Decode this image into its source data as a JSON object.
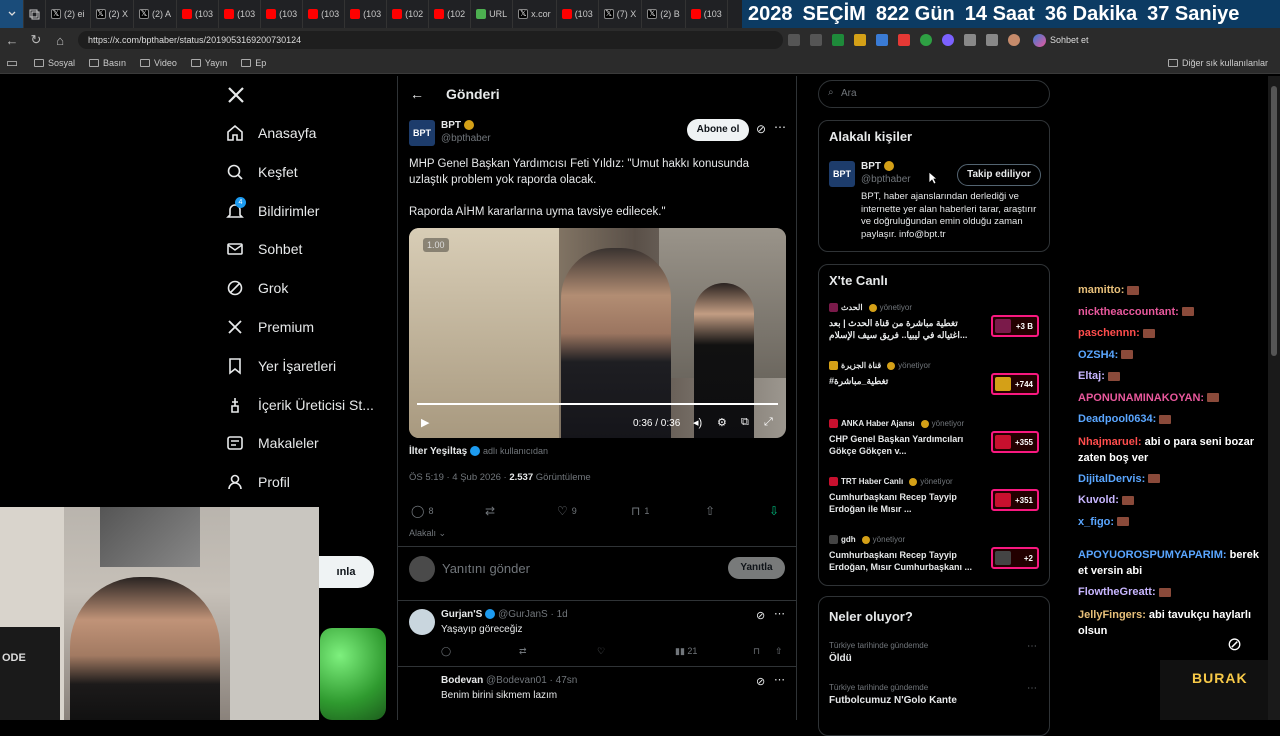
{
  "browser": {
    "tabs": [
      {
        "label": "(2) ei",
        "kind": "x"
      },
      {
        "label": "(2) X",
        "kind": "x"
      },
      {
        "label": "(2) A",
        "kind": "x"
      },
      {
        "label": "(103",
        "kind": "yt"
      },
      {
        "label": "(103",
        "kind": "yt"
      },
      {
        "label": "(103",
        "kind": "yt"
      },
      {
        "label": "(103",
        "kind": "yt"
      },
      {
        "label": "(103",
        "kind": "yt"
      },
      {
        "label": "(102",
        "kind": "yt"
      },
      {
        "label": "(102",
        "kind": "yt"
      },
      {
        "label": "URL",
        "kind": "other"
      },
      {
        "label": "x.cor",
        "kind": "x"
      },
      {
        "label": "(103",
        "kind": "yt"
      },
      {
        "label": "(7) X",
        "kind": "x"
      },
      {
        "label": "(2) B",
        "kind": "x"
      },
      {
        "label": "(103",
        "kind": "yt"
      }
    ],
    "url": "https://x.com/bpthaber/status/2019053169200730124",
    "copilot_label": "Sohbet et",
    "bookmarks": [
      "Sosyal",
      "Basın",
      "Video",
      "Yayın",
      "Ep"
    ],
    "other_bookmarks": "Diğer sık kullanılanlar"
  },
  "countdown": {
    "year": "2028",
    "word": "SEÇİM",
    "days": "822 Gün",
    "hours": "14 Saat",
    "minutes": "36 Dakika",
    "seconds": "37 Saniye"
  },
  "leftnav": {
    "items": [
      {
        "label": "Anasayfa",
        "icon": "home-icon"
      },
      {
        "label": "Keşfet",
        "icon": "search-icon"
      },
      {
        "label": "Bildirimler",
        "icon": "bell-icon",
        "badge": "4"
      },
      {
        "label": "Sohbet",
        "icon": "mail-icon"
      },
      {
        "label": "Grok",
        "icon": "grok-icon"
      },
      {
        "label": "Premium",
        "icon": "x-logo-icon"
      },
      {
        "label": "Yer İşaretleri",
        "icon": "bookmark-icon"
      },
      {
        "label": "İçerik Üreticisi St...",
        "icon": "creator-icon"
      },
      {
        "label": "Makaleler",
        "icon": "article-icon"
      },
      {
        "label": "Profil",
        "icon": "person-icon"
      }
    ],
    "post_button_partial": "ınla"
  },
  "main": {
    "header_title": "Gönderi",
    "tweet": {
      "author_name": "BPT",
      "author_handle": "@bpthaber",
      "subscribe_label": "Abone ol",
      "text_line1": "MHP Genel Başkan Yardımcısı Feti Yıldız: \"Umut hakkı konusunda uzlaştık problem yok raporda olacak.",
      "text_line2": "Raporda AİHM kararlarına uyma tavsiye edilecek.\"",
      "video_tag": "1.00",
      "video_time": "0:36 / 0:36",
      "video_progress": 1.0,
      "attrib_name": "İlter Yeşiltaş",
      "attrib_suffix": "adlı kullanıcıdan",
      "meta_time": "ÖS 5:19 · 4 Şub 2026 ·",
      "views_count": "2.537",
      "views_label": "Görüntüleme",
      "replies": "8",
      "likes": "9",
      "bookmarks": "1",
      "relevance_label": "Alakalı"
    },
    "reply_box": {
      "placeholder": "Yanıtını gönder",
      "button": "Yanıtla"
    },
    "replies": [
      {
        "name": "Gurjan'S",
        "handle": "@GurJanS · 1d",
        "text": "Yaşayıp göreceğiz",
        "views": "21"
      },
      {
        "name": "Bodevan",
        "handle": "@Bodevan01 · 47sn",
        "text": "Benim birini sikmem lazım",
        "views": ""
      }
    ]
  },
  "right": {
    "search_placeholder": "Ara",
    "related": {
      "title": "Alakalı kişiler",
      "name": "BPT",
      "handle": "@bpthaber",
      "follow_label": "Takip ediliyor",
      "bio": "BPT, haber ajanslarından derlediği ve internette yer alan haberleri tarar, araştırır ve doğruluğundan emin olduğu zaman paylaşır. info@bpt.tr"
    },
    "live": {
      "title": "X'te Canlı",
      "items": [
        {
          "source": "الحدث",
          "status": "yönetiyor",
          "title": "تغطية مباشرة من قناة الحدث | بعد اغتياله في ليبيا.. فريق سيف الإسلام...",
          "count": "+3 B"
        },
        {
          "source": "قناة الجزيرة",
          "status": "yönetiyor",
          "title": "#تغطية_مباشرة",
          "count": "+744"
        },
        {
          "source": "ANKA Haber Ajansı",
          "status": "yönetiyor",
          "title": "CHP Genel Başkan Yardımcıları Gökçe Gökçen v...",
          "count": "+355"
        },
        {
          "source": "TRT Haber Canlı",
          "status": "yönetiyor",
          "title": "Cumhurbaşkanı Recep Tayyip Erdoğan ile Mısır ...",
          "count": "+351"
        },
        {
          "source": "gdh",
          "status": "yönetiyor",
          "title": "Cumhurbaşkanı Recep Tayyip Erdoğan, Mısır Cumhurbaşkanı ...",
          "count": "+2"
        }
      ]
    },
    "trends": {
      "title": "Neler oluyor?",
      "items": [
        {
          "context": "Türkiye tarihinde gündemde",
          "name": "Öldü"
        },
        {
          "context": "Türkiye tarihinde gündemde",
          "name": "Futbolcumuz N'Golo Kante"
        }
      ]
    }
  },
  "chat": {
    "messages": [
      {
        "user": "mamitto:",
        "color": "#e8c07a",
        "text": ""
      },
      {
        "user": "nicktheaccountant:",
        "color": "#e8589c",
        "text": ""
      },
      {
        "user": "paschennn:",
        "color": "#ff4d4d",
        "text": ""
      },
      {
        "user": "OZSH4:",
        "color": "#5aa6ff",
        "text": ""
      },
      {
        "user": "Eltaj:",
        "color": "#c8b6ff",
        "text": ""
      },
      {
        "user": "APONUNAMINAKOYAN:",
        "color": "#e8589c",
        "text": ""
      },
      {
        "user": "Deadpool0634:",
        "color": "#5aa6ff",
        "text": ""
      },
      {
        "user": "Nhajmaruel:",
        "color": "#ff4d4d",
        "text": "abi o para seni bozar zaten boş ver"
      },
      {
        "user": "DijitalDervis:",
        "color": "#5aa6ff",
        "text": ""
      },
      {
        "user": "Kuvold:",
        "color": "#c8b6ff",
        "text": ""
      },
      {
        "user": "x_figo:",
        "color": "#5aa6ff",
        "text": ""
      },
      {
        "user": "APOYUOROSPUMYAPARIM:",
        "color": "#5aa6ff",
        "text": "berek et versin abi"
      },
      {
        "user": "FlowtheGreatt:",
        "color": "#c8b6ff",
        "text": ""
      },
      {
        "user": "JellyFingers:",
        "color": "#e8c07a",
        "text": "abi tavukçu haylarlı olsun"
      }
    ]
  },
  "stream": {
    "streamer": "BURAK",
    "overlay_partial": "ODE"
  }
}
